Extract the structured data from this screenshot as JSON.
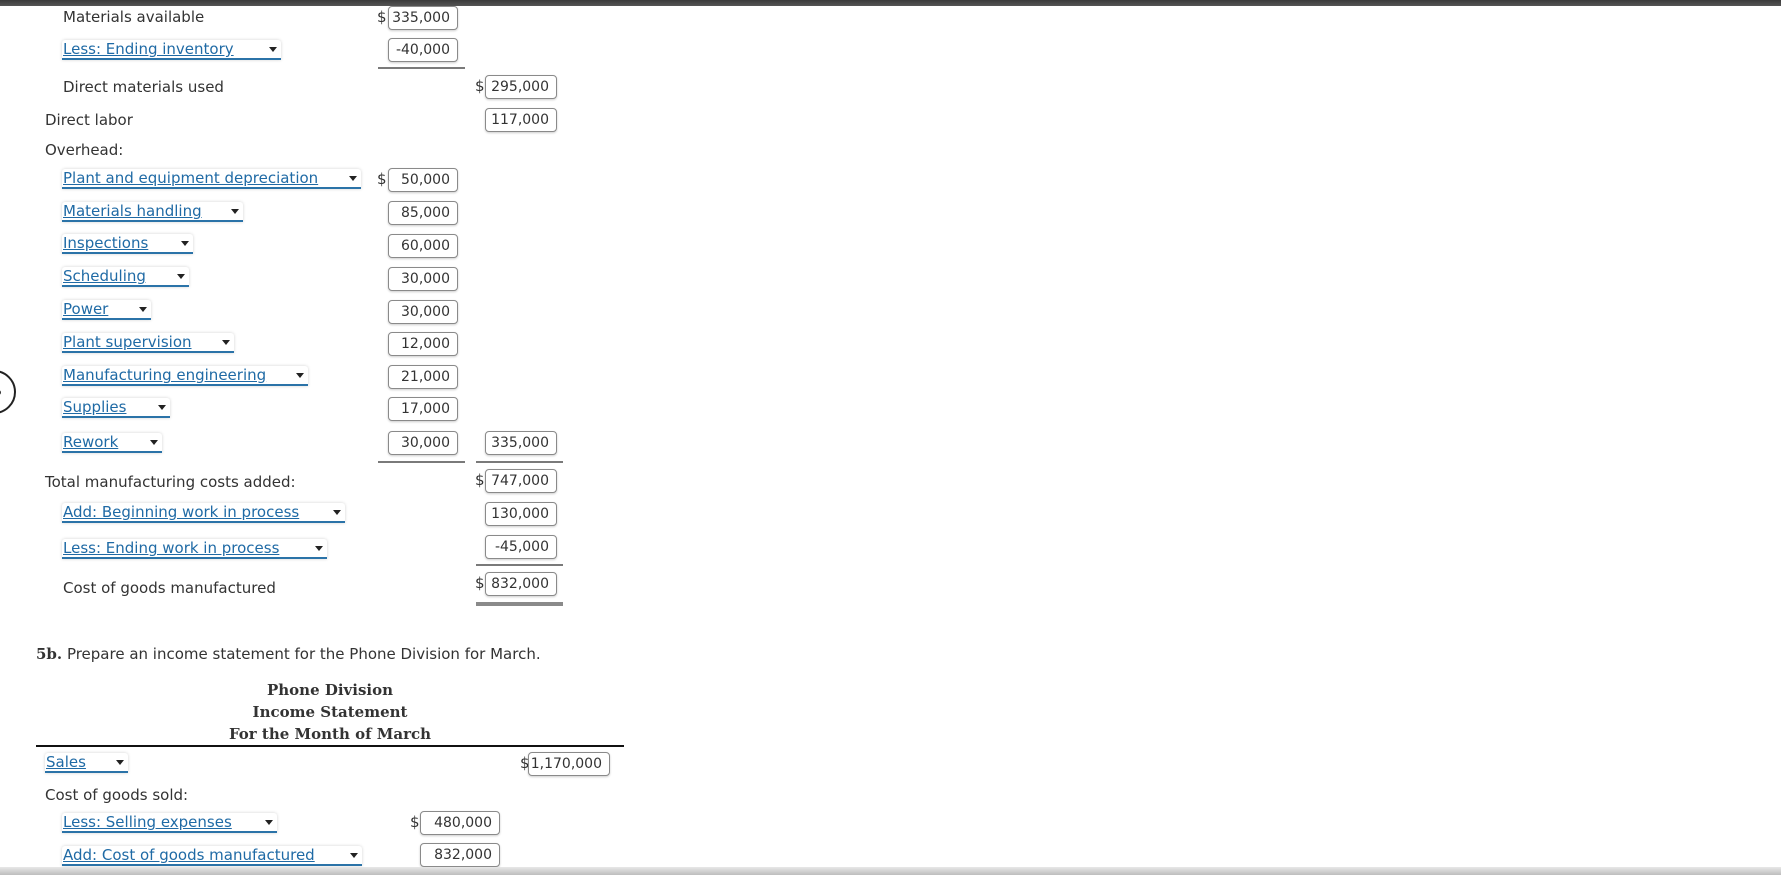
{
  "schedule": {
    "materials_available": {
      "label": "Materials available",
      "currency": "$",
      "value": "335,000"
    },
    "less_ending_inventory": {
      "label": "Less: Ending inventory",
      "value": "-40,000"
    },
    "direct_materials_used": {
      "label": "Direct materials used",
      "currency": "$",
      "value": "295,000"
    },
    "direct_labor": {
      "label": "Direct labor",
      "value": "117,000"
    },
    "overhead_label": "Overhead:",
    "overhead_items": [
      {
        "label": "Plant and equipment depreciation",
        "value": "50,000",
        "currency": "$"
      },
      {
        "label": "Materials handling",
        "value": "85,000"
      },
      {
        "label": "Inspections",
        "value": "60,000"
      },
      {
        "label": "Scheduling",
        "value": "30,000"
      },
      {
        "label": "Power",
        "value": "30,000"
      },
      {
        "label": "Plant supervision",
        "value": "12,000"
      },
      {
        "label": "Manufacturing engineering",
        "value": "21,000"
      },
      {
        "label": "Supplies",
        "value": "17,000"
      },
      {
        "label": "Rework",
        "value": "30,000"
      }
    ],
    "overhead_total": "335,000",
    "total_manufacturing_costs": {
      "label": "Total manufacturing costs added:",
      "currency": "$",
      "value": "747,000"
    },
    "add_beginning_wip": {
      "label": "Add: Beginning work in process",
      "value": "130,000"
    },
    "less_ending_wip": {
      "label": "Less: Ending work in process",
      "value": "-45,000"
    },
    "cost_of_goods_manufactured": {
      "label": "Cost of goods manufactured",
      "currency": "$",
      "value": "832,000"
    }
  },
  "part_5b": {
    "number": "5b.",
    "instruction": "Prepare an income statement for the Phone Division for March.",
    "header": [
      "Phone Division",
      "Income Statement",
      "For the Month of March"
    ],
    "sales": {
      "label": "Sales",
      "currency": "$",
      "value": "1,170,000"
    },
    "cogs_label": "Cost of goods sold:",
    "less_selling_expenses": {
      "label": "Less: Selling expenses",
      "currency": "$",
      "value": "480,000"
    },
    "add_cogm": {
      "label": "Add: Cost of goods manufactured",
      "value": "832,000"
    }
  },
  "icons": {
    "side_nav": "circle-arrow-icon",
    "dropdown": "caret-down-icon"
  }
}
